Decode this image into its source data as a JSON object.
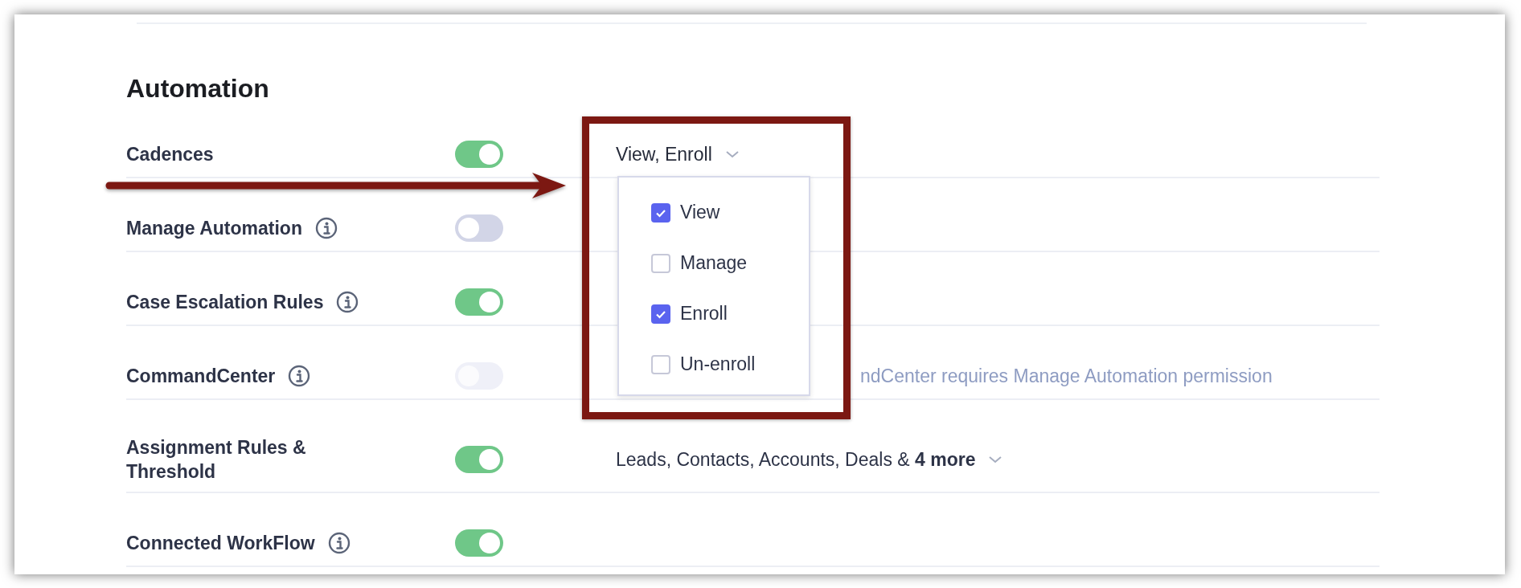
{
  "section": {
    "title": "Automation"
  },
  "rows": [
    {
      "label": "Cadences",
      "info": false,
      "toggle": {
        "on": true,
        "disabled": false
      },
      "value": {
        "kind": "select",
        "text": "View, Enroll",
        "open": true
      }
    },
    {
      "label": "Manage Automation",
      "info": true,
      "toggle": {
        "on": false,
        "disabled": false
      }
    },
    {
      "label": "Case Escalation Rules",
      "info": true,
      "toggle": {
        "on": true,
        "disabled": false
      }
    },
    {
      "label": "CommandCenter",
      "info": true,
      "toggle": {
        "on": false,
        "disabled": true
      },
      "value": {
        "kind": "note",
        "text": "ndCenter requires Manage Automation permission"
      }
    },
    {
      "label": "Assignment Rules & Threshold",
      "info": false,
      "toggle": {
        "on": true,
        "disabled": false
      },
      "value": {
        "kind": "select",
        "text": "Leads, Contacts, Accounts, Deals & **4 more**",
        "open": false
      }
    },
    {
      "label": "Connected WorkFlow",
      "info": true,
      "toggle": {
        "on": true,
        "disabled": false
      }
    }
  ],
  "dropdown": {
    "options": [
      {
        "label": "View",
        "checked": true
      },
      {
        "label": "Manage",
        "checked": false
      },
      {
        "label": "Enroll",
        "checked": true
      },
      {
        "label": "Un-enroll",
        "checked": false
      }
    ]
  }
}
